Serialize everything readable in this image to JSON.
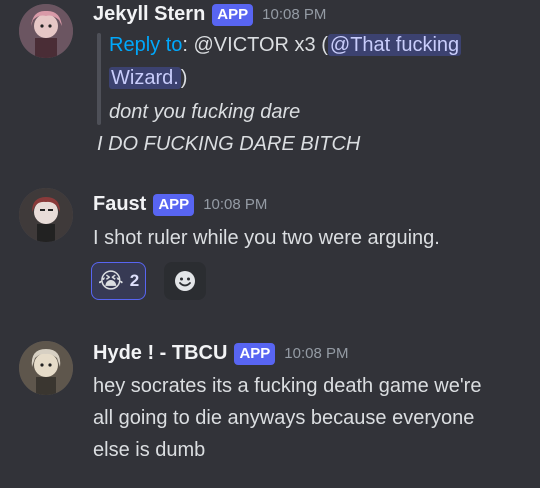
{
  "messages": [
    {
      "username": "Jekyll Stern",
      "badge": "APP",
      "time": "10:08 PM",
      "reply": {
        "prefix": "Reply to",
        "target": ": @VICTOR x3 (",
        "mention_part1": "@That fucking",
        "mention_part2": "Wizard.",
        "suffix": ")"
      },
      "quote": "dont you fucking dare",
      "body": "I DO FUCKING DARE BITCH"
    },
    {
      "username": "Faust",
      "badge": "APP",
      "time": "10:08 PM",
      "body": "I shot ruler while you two were arguing.",
      "reaction": {
        "emoji": "😭",
        "count": "2"
      }
    },
    {
      "username": "Hyde ! - TBCU",
      "badge": "APP",
      "time": "10:08 PM",
      "body_lines": [
        "hey socrates its a fucking death game we're",
        "all going to die anyways because everyone",
        "else is dumb"
      ]
    }
  ],
  "icons": {
    "add_reaction": "smiley-add-reaction-icon"
  },
  "colors": {
    "background": "#323339",
    "badge": "#5865f2",
    "reply_link": "#00a8fc",
    "mention_bg": "#3c4270"
  }
}
